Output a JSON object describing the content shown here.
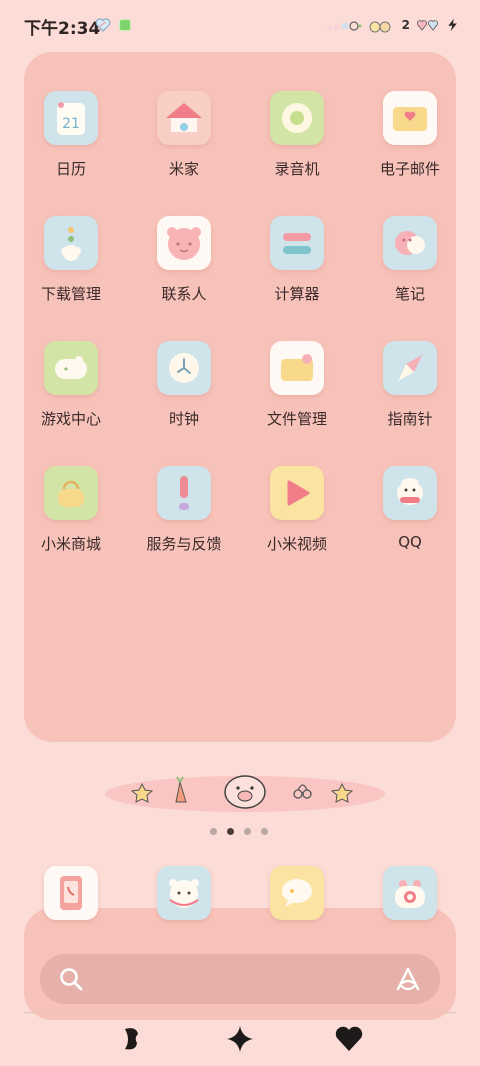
{
  "status_bar": {
    "time": "下午2:34",
    "notification_count": "2",
    "icons": [
      "heart-sticker-icon",
      "app-notification-dot",
      "signal-hearts-icon",
      "wifi-hearts-icon",
      "battery-hearts-icon",
      "charging-bolt-icon"
    ]
  },
  "apps": [
    {
      "label": "日历",
      "icon": "calendar-icon",
      "icon_text": "21"
    },
    {
      "label": "米家",
      "icon": "home-icon"
    },
    {
      "label": "录音机",
      "icon": "recorder-icon"
    },
    {
      "label": "电子邮件",
      "icon": "mail-icon"
    },
    {
      "label": "下载管理",
      "icon": "download-icon"
    },
    {
      "label": "联系人",
      "icon": "contacts-icon"
    },
    {
      "label": "计算器",
      "icon": "calculator-icon"
    },
    {
      "label": "笔记",
      "icon": "notes-icon"
    },
    {
      "label": "游戏中心",
      "icon": "game-center-icon"
    },
    {
      "label": "时钟",
      "icon": "clock-icon"
    },
    {
      "label": "文件管理",
      "icon": "file-manager-icon"
    },
    {
      "label": "指南针",
      "icon": "compass-icon"
    },
    {
      "label": "小米商城",
      "icon": "shop-bag-icon"
    },
    {
      "label": "服务与反馈",
      "icon": "feedback-icon"
    },
    {
      "label": "小米视频",
      "icon": "video-play-icon"
    },
    {
      "label": "QQ",
      "icon": "qq-icon"
    }
  ],
  "page_indicator": {
    "count": 4,
    "active": 1
  },
  "dock": [
    {
      "name": "phone",
      "icon": "phone-icon"
    },
    {
      "name": "messages-cat",
      "icon": "cat-icon"
    },
    {
      "name": "messages",
      "icon": "chat-bubble-icon"
    },
    {
      "name": "camera",
      "icon": "camera-icon"
    }
  ],
  "nav": [
    "back-icon",
    "home-star-icon",
    "recents-heart-icon"
  ],
  "colors": {
    "background": "#fcdcd6",
    "panel": "#f7c2b9",
    "search": "#e6b1aa",
    "text": "#3a2a2a"
  }
}
